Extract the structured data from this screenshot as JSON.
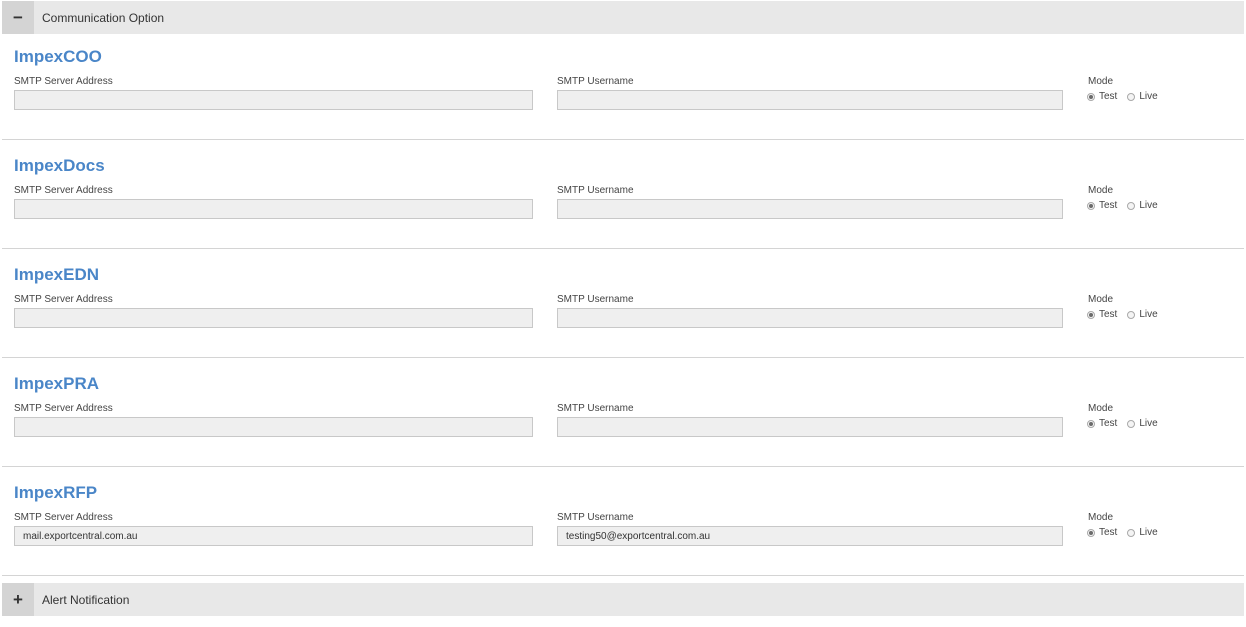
{
  "panels": {
    "communication": {
      "toggle_symbol": "−",
      "title": "Communication Option"
    },
    "alert": {
      "toggle_symbol": "+",
      "title": "Alert Notification"
    }
  },
  "sections": [
    {
      "name": "ImpexCOO",
      "server_label": "SMTP Server Address",
      "server_value": "",
      "user_label": "SMTP Username",
      "user_value": "",
      "mode_label": "Mode",
      "mode_options": [
        "Test",
        "Live"
      ],
      "mode_selected": "Test"
    },
    {
      "name": "ImpexDocs",
      "server_label": "SMTP Server Address",
      "server_value": "",
      "user_label": "SMTP Username",
      "user_value": "",
      "mode_label": "Mode",
      "mode_options": [
        "Test",
        "Live"
      ],
      "mode_selected": "Test"
    },
    {
      "name": "ImpexEDN",
      "server_label": "SMTP Server Address",
      "server_value": "",
      "user_label": "SMTP Username",
      "user_value": "",
      "mode_label": "Mode",
      "mode_options": [
        "Test",
        "Live"
      ],
      "mode_selected": "Test"
    },
    {
      "name": "ImpexPRA",
      "server_label": "SMTP Server Address",
      "server_value": "",
      "user_label": "SMTP Username",
      "user_value": "",
      "mode_label": "Mode",
      "mode_options": [
        "Test",
        "Live"
      ],
      "mode_selected": "Test"
    },
    {
      "name": "ImpexRFP",
      "server_label": "SMTP Server Address",
      "server_value": "mail.exportcentral.com.au",
      "user_label": "SMTP Username",
      "user_value": "testing50@exportcentral.com.au",
      "mode_label": "Mode",
      "mode_options": [
        "Test",
        "Live"
      ],
      "mode_selected": "Test"
    }
  ],
  "colors": {
    "accent": "#4a86c8",
    "header_bg": "#e8e8e8",
    "input_bg": "#efefef"
  }
}
